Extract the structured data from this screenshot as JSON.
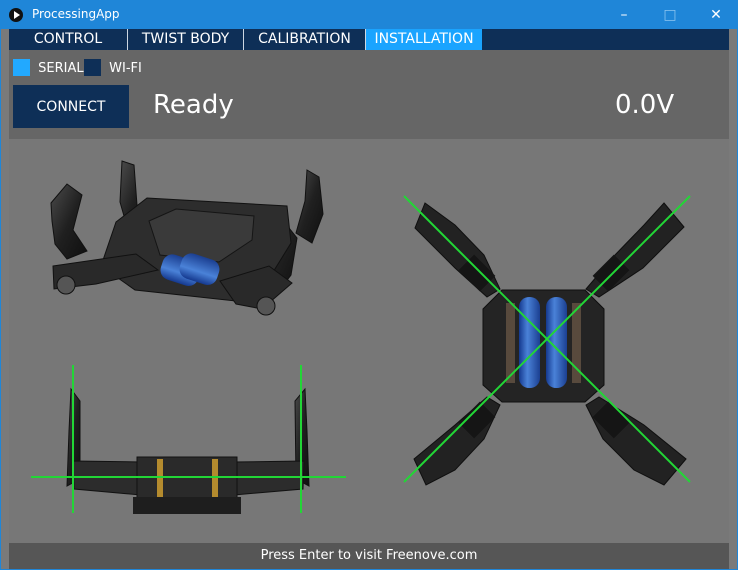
{
  "window": {
    "title": "ProcessingApp",
    "controls": {
      "minimize": "–",
      "maximize": "□",
      "close": "✕"
    }
  },
  "tabs": [
    {
      "label": "CONTROL"
    },
    {
      "label": "TWIST BODY"
    },
    {
      "label": "CALIBRATION"
    },
    {
      "label": "INSTALLATION"
    }
  ],
  "connection": {
    "options": [
      {
        "label": "SERIAL",
        "selected": true
      },
      {
        "label": "WI-FI",
        "selected": false
      }
    ],
    "connect_button": "CONNECT",
    "status": "Ready",
    "voltage": "0.0V"
  },
  "footer": {
    "text": "Press Enter to visit Freenove.com"
  },
  "images": [
    {
      "name": "robot-perspective-view",
      "icon": "robot-dog-icon"
    },
    {
      "name": "robot-front-view",
      "icon": "robot-dog-front-icon"
    },
    {
      "name": "robot-top-view",
      "icon": "robot-dog-top-icon"
    }
  ],
  "colors": {
    "title_bar": "#1f86d8",
    "active_tab": "#1aa4ff",
    "dark_navy": "#0e2f57",
    "toolbar": "#666666",
    "canvas": "#777777",
    "footer": "#565656",
    "guide_lines": "#22d636"
  }
}
